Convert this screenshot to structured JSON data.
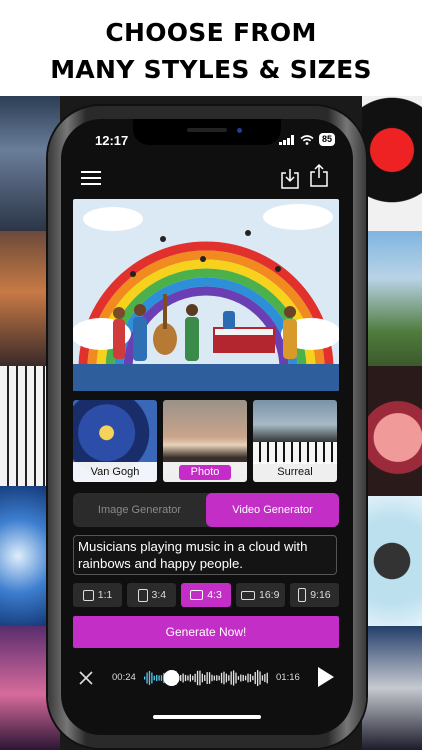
{
  "headline": {
    "line1": "CHOOSE FROM",
    "line2": "MANY STYLES & SIZES"
  },
  "status": {
    "time": "12:17",
    "battery": "85"
  },
  "icons": {
    "menu": "hamburger-menu-icon",
    "import": "import-icon",
    "share": "share-icon",
    "close": "close-icon",
    "play": "play-icon"
  },
  "styles": [
    {
      "label": "Van Gogh",
      "selected": false
    },
    {
      "label": "Photo",
      "selected": true
    },
    {
      "label": "Surreal",
      "selected": false
    }
  ],
  "modes": {
    "image": "Image Generator",
    "video": "Video Generator",
    "active": "video"
  },
  "prompt": {
    "value": "Musicians playing music in a cloud with rainbows and happy people."
  },
  "sizes": [
    {
      "label": "1:1",
      "selected": false
    },
    {
      "label": "3:4",
      "selected": false
    },
    {
      "label": "4:3",
      "selected": true
    },
    {
      "label": "16:9",
      "selected": false
    },
    {
      "label": "9:16",
      "selected": false
    }
  ],
  "generate": {
    "label": "Generate Now!"
  },
  "player": {
    "elapsed": "00:24",
    "total": "01:16",
    "progress": 0.22
  },
  "colors": {
    "accent": "#c32ec6",
    "screen_bg": "#0f0f0f",
    "panel": "#2b2b2b"
  }
}
